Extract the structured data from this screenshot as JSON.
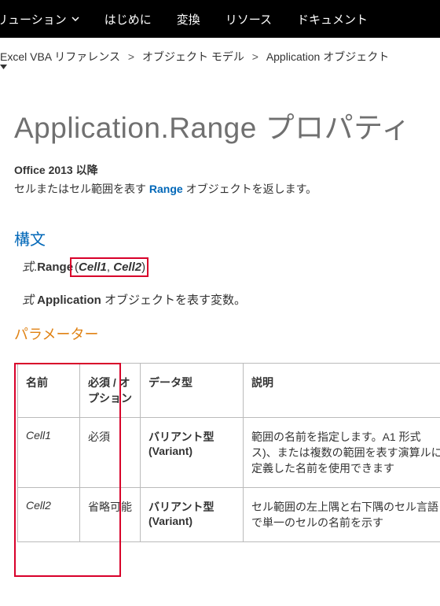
{
  "topnav": {
    "items": [
      {
        "label": "リューション"
      },
      {
        "label": "はじめに"
      },
      {
        "label": "変換"
      },
      {
        "label": "リソース"
      },
      {
        "label": "ドキュメント"
      }
    ]
  },
  "breadcrumb": {
    "items": [
      "Excel VBA リファレンス",
      "オブジェクト モデル",
      "Application オブジェクト"
    ]
  },
  "page": {
    "title": "Application.Range プロパティ",
    "office": "Office 2013 以降",
    "intro_pre": "セルまたはセル範囲を表す ",
    "intro_link": "Range",
    "intro_post": " オブジェクトを返します。"
  },
  "syntax": {
    "heading": "構文",
    "expr": "式",
    "dot": ".",
    "member": "Range",
    "paren_open": "(",
    "arg1": "Cell1",
    "comma": ", ",
    "arg2": "Cell2",
    "paren_close": ")",
    "var_expr": "式 ",
    "var_obj": "Application",
    "var_desc": " オブジェクトを表す変数。"
  },
  "params": {
    "heading": "パラメーター",
    "headers": {
      "name": "名前",
      "required": "必須 / オプション",
      "type": "データ型",
      "desc": "説明"
    },
    "rows": [
      {
        "name": "Cell1",
        "required": "必須",
        "type": "バリアント型 (Variant)",
        "desc": "範囲の名前を指定します。A1 形式ス)、または複数の範囲を表す演算ルに定義した名前を使用できます"
      },
      {
        "name": "Cell2",
        "required": "省略可能",
        "type": "バリアント型 (Variant)",
        "desc": "セル範囲の左上隅と右下隅のセル言語で単一のセルの名前を示す"
      }
    ]
  }
}
